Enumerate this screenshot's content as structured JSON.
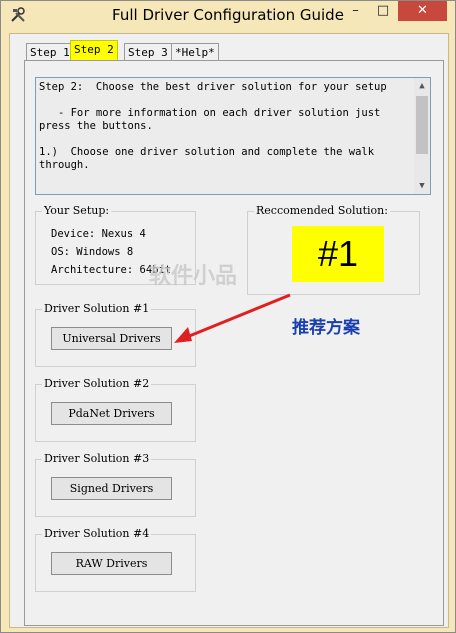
{
  "window": {
    "title": "Full Driver Configuration Guide",
    "controls": {
      "minimize": "–",
      "maximize": "□",
      "close": "✕"
    }
  },
  "tabs": [
    {
      "label": "Step 1",
      "active": false
    },
    {
      "label": "Step 2",
      "active": true
    },
    {
      "label": "Step 3",
      "active": false
    },
    {
      "label": "*Help*",
      "active": false
    }
  ],
  "instructions": {
    "text": "Step 2:  Choose the best driver solution for your setup\n\n   - For more information on each driver solution just press the buttons.\n\n1.)  Choose one driver solution and complete the walk through."
  },
  "your_setup": {
    "legend": "Your Setup:",
    "device": "Device: Nexus 4",
    "os": "OS: Windows 8",
    "architecture": "Architecture: 64bit"
  },
  "recommended": {
    "legend": "Reccomended Solution:",
    "value": "#1"
  },
  "solutions": [
    {
      "legend": "Driver Solution #1",
      "button": "Universal Drivers"
    },
    {
      "legend": "Driver Solution #2",
      "button": "PdaNet Drivers"
    },
    {
      "legend": "Driver Solution #3",
      "button": "Signed Drivers"
    },
    {
      "legend": "Driver Solution #4",
      "button": "RAW Drivers"
    }
  ],
  "annotation": {
    "text": "推荐方案",
    "color": "#1a3fb0"
  },
  "watermark": {
    "text": "软件小品"
  },
  "colors": {
    "highlight": "#ffff00",
    "arrow": "#e02020",
    "close_button": "#c7483c"
  }
}
